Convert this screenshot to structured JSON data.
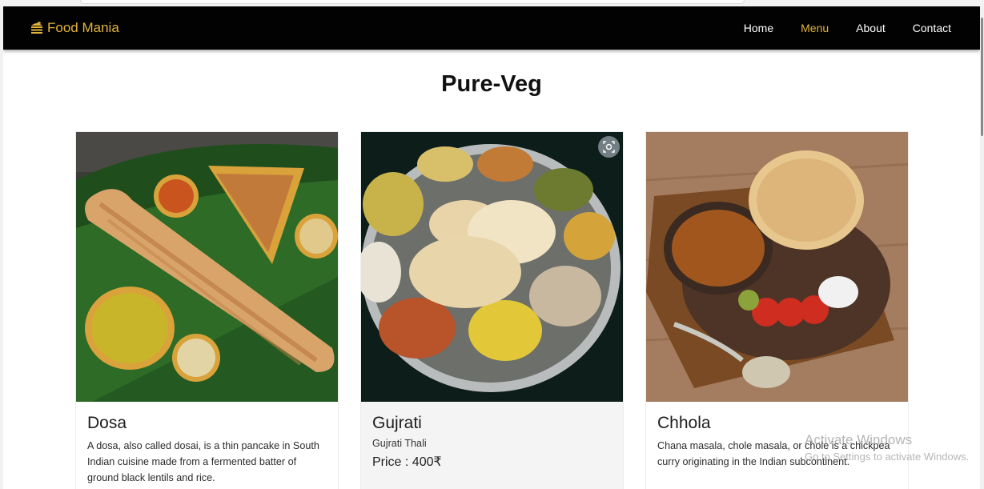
{
  "brand": {
    "name": "Food Mania",
    "icon": "burger-icon",
    "color": "#e2b43a"
  },
  "nav": {
    "items": [
      {
        "label": "Home",
        "active": false
      },
      {
        "label": "Menu",
        "active": true
      },
      {
        "label": "About",
        "active": false
      },
      {
        "label": "Contact",
        "active": false
      }
    ]
  },
  "section": {
    "title": "Pure-Veg"
  },
  "cards": [
    {
      "title": "Dosa",
      "image": "dosa-photo",
      "description": "A dosa, also called dosai, is a thin pancake in South Indian cuisine made from a fermented batter of ground black lentils and rice."
    },
    {
      "title": "Gujrati",
      "image": "gujrati-thali-photo",
      "subtitle": "Gujrati Thali",
      "price": "Price : 400₹"
    },
    {
      "title": "Chhola",
      "image": "chhola-bhature-photo",
      "description": "Chana masala, chole masala, or chole is a chickpea curry originating in the Indian subcontinent."
    }
  ],
  "watermark": {
    "title": "Activate Windows",
    "subtitle": "Go to Settings to activate Windows."
  }
}
